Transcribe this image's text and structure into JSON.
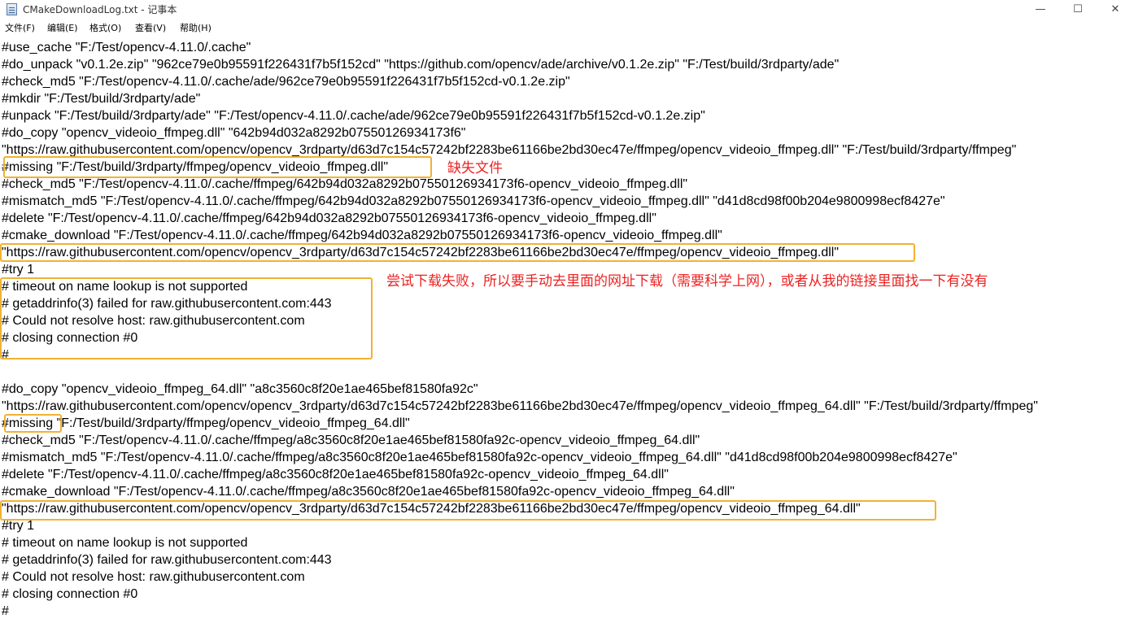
{
  "window": {
    "title": "CMakeDownloadLog.txt - 记事本",
    "minimize_glyph": "—",
    "maximize_glyph": "☐",
    "close_glyph": "✕"
  },
  "menu": [
    "文件(F)",
    "编辑(E)",
    "格式(O)",
    "查看(V)",
    "帮助(H)"
  ],
  "lines": [
    "#use_cache \"F:/Test/opencv-4.11.0/.cache\"",
    "#do_unpack \"v0.1.2e.zip\" \"962ce79e0b95591f226431f7b5f152cd\" \"https://github.com/opencv/ade/archive/v0.1.2e.zip\" \"F:/Test/build/3rdparty/ade\"",
    "#check_md5 \"F:/Test/opencv-4.11.0/.cache/ade/962ce79e0b95591f226431f7b5f152cd-v0.1.2e.zip\"",
    "#mkdir \"F:/Test/build/3rdparty/ade\"",
    "#unpack \"F:/Test/build/3rdparty/ade\" \"F:/Test/opencv-4.11.0/.cache/ade/962ce79e0b95591f226431f7b5f152cd-v0.1.2e.zip\"",
    "#do_copy \"opencv_videoio_ffmpeg.dll\" \"642b94d032a8292b07550126934173f6\"",
    "\"https://raw.githubusercontent.com/opencv/opencv_3rdparty/d63d7c154c57242bf2283be61166be2bd30ec47e/ffmpeg/opencv_videoio_ffmpeg.dll\" \"F:/Test/build/3rdparty/ffmpeg\"",
    "#missing \"F:/Test/build/3rdparty/ffmpeg/opencv_videoio_ffmpeg.dll\"",
    "#check_md5 \"F:/Test/opencv-4.11.0/.cache/ffmpeg/642b94d032a8292b07550126934173f6-opencv_videoio_ffmpeg.dll\"",
    "#mismatch_md5 \"F:/Test/opencv-4.11.0/.cache/ffmpeg/642b94d032a8292b07550126934173f6-opencv_videoio_ffmpeg.dll\" \"d41d8cd98f00b204e9800998ecf8427e\"",
    "#delete \"F:/Test/opencv-4.11.0/.cache/ffmpeg/642b94d032a8292b07550126934173f6-opencv_videoio_ffmpeg.dll\"",
    "#cmake_download \"F:/Test/opencv-4.11.0/.cache/ffmpeg/642b94d032a8292b07550126934173f6-opencv_videoio_ffmpeg.dll\"",
    "\"https://raw.githubusercontent.com/opencv/opencv_3rdparty/d63d7c154c57242bf2283be61166be2bd30ec47e/ffmpeg/opencv_videoio_ffmpeg.dll\"",
    "#try 1",
    "# timeout on name lookup is not supported",
    "# getaddrinfo(3) failed for raw.githubusercontent.com:443",
    "# Could not resolve host: raw.githubusercontent.com",
    "# closing connection #0",
    "#",
    "",
    "#do_copy \"opencv_videoio_ffmpeg_64.dll\" \"a8c3560c8f20e1ae465bef81580fa92c\"",
    "\"https://raw.githubusercontent.com/opencv/opencv_3rdparty/d63d7c154c57242bf2283be61166be2bd30ec47e/ffmpeg/opencv_videoio_ffmpeg_64.dll\" \"F:/Test/build/3rdparty/ffmpeg\"",
    "#missing \"F:/Test/build/3rdparty/ffmpeg/opencv_videoio_ffmpeg_64.dll\"",
    "#check_md5 \"F:/Test/opencv-4.11.0/.cache/ffmpeg/a8c3560c8f20e1ae465bef81580fa92c-opencv_videoio_ffmpeg_64.dll\"",
    "#mismatch_md5 \"F:/Test/opencv-4.11.0/.cache/ffmpeg/a8c3560c8f20e1ae465bef81580fa92c-opencv_videoio_ffmpeg_64.dll\" \"d41d8cd98f00b204e9800998ecf8427e\"",
    "#delete \"F:/Test/opencv-4.11.0/.cache/ffmpeg/a8c3560c8f20e1ae465bef81580fa92c-opencv_videoio_ffmpeg_64.dll\"",
    "#cmake_download \"F:/Test/opencv-4.11.0/.cache/ffmpeg/a8c3560c8f20e1ae465bef81580fa92c-opencv_videoio_ffmpeg_64.dll\"",
    "\"https://raw.githubusercontent.com/opencv/opencv_3rdparty/d63d7c154c57242bf2283be61166be2bd30ec47e/ffmpeg/opencv_videoio_ffmpeg_64.dll\"",
    "#try 1",
    "# timeout on name lookup is not supported",
    "# getaddrinfo(3) failed for raw.githubusercontent.com:443",
    "# Could not resolve host: raw.githubusercontent.com",
    "# closing connection #0",
    "#"
  ],
  "annotations": {
    "missing_file": "缺失文件",
    "download_failed": "尝试下载失败，所以要手动去里面的网址下载（需要科学上网），或者从我的链接里面找一下有没有"
  },
  "colors": {
    "highlight_box": "#f2b134",
    "annotation_text": "#ee2222"
  }
}
